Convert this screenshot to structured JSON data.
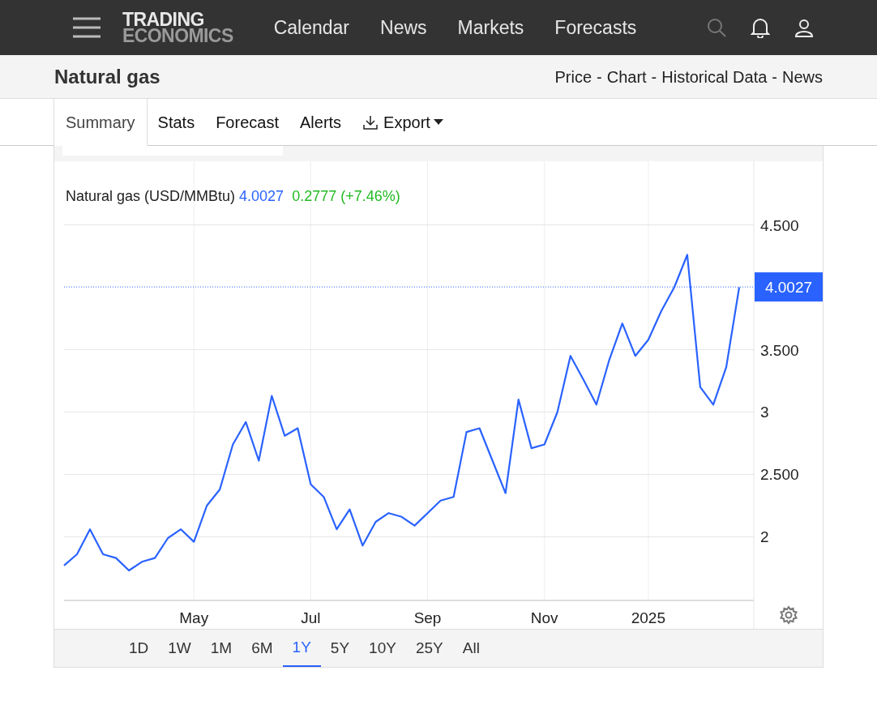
{
  "header": {
    "logo": [
      "TRADING",
      "ECONOMICS"
    ],
    "nav": [
      "Calendar",
      "News",
      "Markets",
      "Forecasts"
    ]
  },
  "page": {
    "title": "Natural gas",
    "links": [
      "Price",
      "Chart",
      "Historical Data",
      "News"
    ],
    "separator": "-"
  },
  "tabs": [
    {
      "label": "Summary",
      "selected": true,
      "kind": "tab"
    },
    {
      "label": "Stats",
      "selected": false,
      "kind": "tab"
    },
    {
      "label": "Forecast",
      "selected": false,
      "kind": "tab"
    },
    {
      "label": "Alerts",
      "selected": false,
      "kind": "tab"
    },
    {
      "label": "Export",
      "selected": false,
      "kind": "dropdown"
    }
  ],
  "chart": {
    "price": "4.0027",
    "change": "0.2777 (+7.46%)",
    "last_label": "4.0027",
    "chart_data": {
      "type": "line",
      "grid": true,
      "ref_lines": [
        {
          "axis": "y",
          "value": 4.0027,
          "color": "#2962ff"
        }
      ],
      "ylim": [
        1.49,
        5.01
      ],
      "yticks": [
        2,
        {
          "value": 2.5,
          "label": "2.500"
        },
        3,
        {
          "value": 3.5,
          "label": "3.500"
        },
        {
          "value": 4.5,
          "label": "4.500"
        }
      ],
      "categories": [
        null,
        null,
        null,
        null,
        null,
        null,
        null,
        null,
        null,
        null,
        "May",
        null,
        null,
        null,
        null,
        null,
        null,
        null,
        null,
        "Jul",
        null,
        null,
        null,
        null,
        null,
        null,
        null,
        null,
        "Sep",
        null,
        null,
        null,
        null,
        null,
        null,
        null,
        null,
        "Nov",
        null,
        null,
        null,
        null,
        null,
        null,
        null,
        "2025",
        null,
        null,
        null,
        null,
        null,
        null,
        null
      ],
      "series": [
        {
          "name": "Natural gas (USD/MMBtu)",
          "color": "#2962ff",
          "values": [
            1.77,
            1.86,
            2.06,
            1.86,
            1.83,
            1.73,
            1.8,
            1.83,
            1.99,
            2.06,
            1.96,
            2.25,
            2.38,
            2.74,
            2.92,
            2.61,
            3.13,
            2.81,
            2.87,
            2.42,
            2.32,
            2.06,
            2.22,
            1.93,
            2.12,
            2.19,
            2.16,
            2.09,
            2.19,
            2.29,
            2.32,
            2.84,
            2.87,
            2.61,
            2.35,
            3.1,
            2.71,
            2.74,
            3.0,
            3.45,
            3.26,
            3.06,
            3.42,
            3.71,
            3.45,
            3.58,
            3.81,
            4.0,
            4.26,
            3.2,
            3.06,
            3.36,
            4.0
          ]
        }
      ]
    }
  },
  "ranges": [
    {
      "label": "1D",
      "selected": false
    },
    {
      "label": "1W",
      "selected": false
    },
    {
      "label": "1M",
      "selected": false
    },
    {
      "label": "6M",
      "selected": false
    },
    {
      "label": "1Y",
      "selected": true
    },
    {
      "label": "5Y",
      "selected": false
    },
    {
      "label": "10Y",
      "selected": false
    },
    {
      "label": "25Y",
      "selected": false
    },
    {
      "label": "All",
      "selected": false
    }
  ]
}
